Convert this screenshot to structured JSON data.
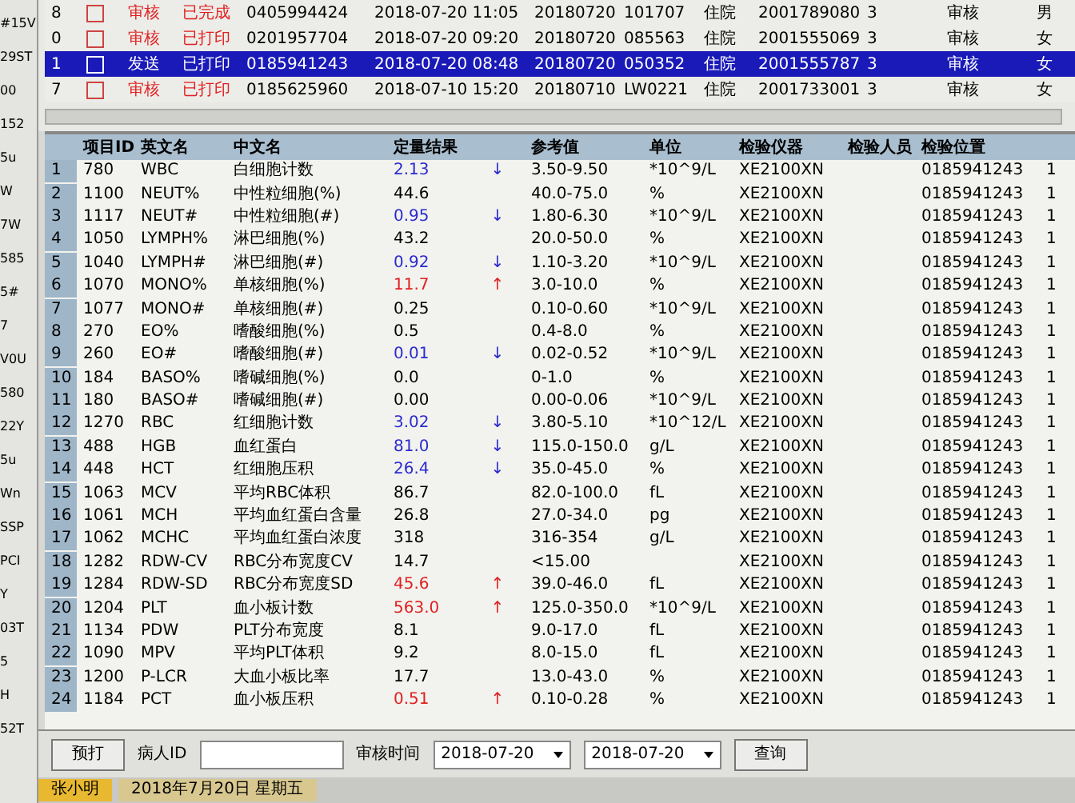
{
  "side_strip": [
    "#15V",
    "29ST",
    "00",
    "152",
    "5u",
    "W",
    "7W",
    "585",
    "5#",
    "7",
    "V0U",
    "580",
    "22Y",
    "5u",
    "Wn",
    "SSP",
    "PCI",
    "Y",
    "03T",
    "5",
    "H",
    "52T"
  ],
  "samples": [
    {
      "index": "8",
      "checked": false,
      "selected": false,
      "status": "审核",
      "kind": "alert",
      "print": "已完成",
      "number": "0405994424",
      "time": "2018-07-20 11:05",
      "date": "20180720",
      "code": "101707",
      "ward": "住院",
      "patient": "2001789080",
      "count": "3",
      "state": "审核",
      "sex": "男"
    },
    {
      "index": "0",
      "checked": false,
      "selected": false,
      "status": "审核",
      "kind": "alert",
      "print": "已打印",
      "number": "0201957704",
      "time": "2018-07-20 09:20",
      "date": "20180720",
      "code": "085563",
      "ward": "住院",
      "patient": "2001555069",
      "count": "3",
      "state": "审核",
      "sex": "女"
    },
    {
      "index": "1",
      "checked": false,
      "selected": true,
      "status": "发送",
      "kind": "normal",
      "print": "已打印",
      "number": "0185941243",
      "time": "2018-07-20 08:48",
      "date": "20180720",
      "code": "050352",
      "ward": "住院",
      "patient": "2001555787",
      "count": "3",
      "state": "审核",
      "sex": "女"
    },
    {
      "index": "7",
      "checked": false,
      "selected": false,
      "status": "审核",
      "kind": "alert",
      "print": "已打印",
      "number": "0185625960",
      "time": "2018-07-10 15:20",
      "date": "20180710",
      "code": "LW0221",
      "ward": "住院",
      "patient": "2001733001",
      "count": "3",
      "state": "审核",
      "sex": "女"
    }
  ],
  "results": {
    "columns": [
      "项目ID",
      "英文名",
      "中文名",
      "定量结果",
      "参考值",
      "单位",
      "检验仪器",
      "检验人员",
      "检验位置"
    ],
    "rows": [
      {
        "no": "1",
        "id": "780",
        "en": "WBC",
        "cn": "白细胞计数",
        "result": "2.13",
        "kind": "low",
        "flag": "↓",
        "ref": "3.50-9.50",
        "unit": "*10^9/L",
        "instrument": "XE2100XN",
        "location": "0185941243",
        "column_11": "1"
      },
      {
        "no": "2",
        "id": "1100",
        "en": "NEUT%",
        "cn": "中性粒细胞(%)",
        "result": "44.6",
        "kind": "normal",
        "ref": "40.0-75.0",
        "unit": "%",
        "instrument": "XE2100XN",
        "location": "0185941243",
        "column_11": "1"
      },
      {
        "no": "3",
        "id": "1117",
        "en": "NEUT#",
        "cn": "中性粒细胞(#)",
        "result": "0.95",
        "kind": "low",
        "flag": "↓",
        "ref": "1.80-6.30",
        "unit": "*10^9/L",
        "instrument": "XE2100XN",
        "location": "0185941243",
        "column_11": "1"
      },
      {
        "no": "4",
        "id": "1050",
        "en": "LYMPH%",
        "cn": "淋巴细胞(%)",
        "result": "43.2",
        "kind": "normal",
        "ref": "20.0-50.0",
        "unit": "%",
        "instrument": "XE2100XN",
        "location": "0185941243",
        "column_11": "1"
      },
      {
        "no": "5",
        "id": "1040",
        "en": "LYMPH#",
        "cn": "淋巴细胞(#)",
        "result": "0.92",
        "kind": "low",
        "flag": "↓",
        "ref": "1.10-3.20",
        "unit": "*10^9/L",
        "instrument": "XE2100XN",
        "location": "0185941243",
        "column_11": "1"
      },
      {
        "no": "6",
        "id": "1070",
        "en": "MONO%",
        "cn": "单核细胞(%)",
        "result": "11.7",
        "kind": "high",
        "flag": "↑",
        "ref": "3.0-10.0",
        "unit": "%",
        "instrument": "XE2100XN",
        "location": "0185941243",
        "column_11": "1"
      },
      {
        "no": "7",
        "id": "1077",
        "en": "MONO#",
        "cn": "单核细胞(#)",
        "result": "0.25",
        "kind": "normal",
        "ref": "0.10-0.60",
        "unit": "*10^9/L",
        "instrument": "XE2100XN",
        "location": "0185941243",
        "column_11": "1"
      },
      {
        "no": "8",
        "id": "270",
        "en": "EO%",
        "cn": "嗜酸细胞(%)",
        "result": "0.5",
        "kind": "normal",
        "ref": "0.4-8.0",
        "unit": "%",
        "instrument": "XE2100XN",
        "location": "0185941243",
        "column_11": "1"
      },
      {
        "no": "9",
        "id": "260",
        "en": "EO#",
        "cn": "嗜酸细胞(#)",
        "result": "0.01",
        "kind": "low",
        "flag": "↓",
        "ref": "0.02-0.52",
        "unit": "*10^9/L",
        "instrument": "XE2100XN",
        "location": "0185941243",
        "column_11": "1"
      },
      {
        "no": "10",
        "id": "184",
        "en": "BASO%",
        "cn": "嗜碱细胞(%)",
        "result": "0.0",
        "kind": "normal",
        "ref": "0-1.0",
        "unit": "%",
        "instrument": "XE2100XN",
        "location": "0185941243",
        "column_11": "1"
      },
      {
        "no": "11",
        "id": "180",
        "en": "BASO#",
        "cn": "嗜碱细胞(#)",
        "result": "0.00",
        "kind": "normal",
        "ref": "0.00-0.06",
        "unit": "*10^9/L",
        "instrument": "XE2100XN",
        "location": "0185941243",
        "column_11": "1"
      },
      {
        "no": "12",
        "id": "1270",
        "en": "RBC",
        "cn": "红细胞计数",
        "result": "3.02",
        "kind": "low",
        "flag": "↓",
        "ref": "3.80-5.10",
        "unit": "*10^12/L",
        "instrument": "XE2100XN",
        "location": "0185941243",
        "column_11": "1"
      },
      {
        "no": "13",
        "id": "488",
        "en": "HGB",
        "cn": "血红蛋白",
        "result": "81.0",
        "kind": "low",
        "flag": "↓",
        "ref": "115.0-150.0",
        "unit": "g/L",
        "instrument": "XE2100XN",
        "location": "0185941243",
        "column_11": "1"
      },
      {
        "no": "14",
        "id": "448",
        "en": "HCT",
        "cn": "红细胞压积",
        "result": "26.4",
        "kind": "low",
        "flag": "↓",
        "ref": "35.0-45.0",
        "unit": "%",
        "instrument": "XE2100XN",
        "location": "0185941243",
        "column_11": "1"
      },
      {
        "no": "15",
        "id": "1063",
        "en": "MCV",
        "cn": "平均RBC体积",
        "result": "86.7",
        "kind": "normal",
        "ref": "82.0-100.0",
        "unit": "fL",
        "instrument": "XE2100XN",
        "location": "0185941243",
        "column_11": "1"
      },
      {
        "no": "16",
        "id": "1061",
        "en": "MCH",
        "cn": "平均血红蛋白含量",
        "result": "26.8",
        "kind": "normal",
        "ref": "27.0-34.0",
        "unit": "pg",
        "instrument": "XE2100XN",
        "location": "0185941243",
        "column_11": "1"
      },
      {
        "no": "17",
        "id": "1062",
        "en": "MCHC",
        "cn": "平均血红蛋白浓度",
        "result": "318",
        "kind": "normal",
        "ref": "316-354",
        "unit": "g/L",
        "instrument": "XE2100XN",
        "location": "0185941243",
        "column_11": "1"
      },
      {
        "no": "18",
        "id": "1282",
        "en": "RDW-CV",
        "cn": "RBC分布宽度CV",
        "result": "14.7",
        "kind": "normal",
        "ref": "<15.00",
        "instrument": "XE2100XN",
        "location": "0185941243",
        "column_11": "1"
      },
      {
        "no": "19",
        "id": "1284",
        "en": "RDW-SD",
        "cn": "RBC分布宽度SD",
        "result": "45.6",
        "kind": "high",
        "flag": "↑",
        "ref": "39.0-46.0",
        "unit": "fL",
        "instrument": "XE2100XN",
        "location": "0185941243",
        "column_11": "1"
      },
      {
        "no": "20",
        "id": "1204",
        "en": "PLT",
        "cn": "血小板计数",
        "result": "563.0",
        "kind": "high",
        "flag": "↑",
        "ref": "125.0-350.0",
        "unit": "*10^9/L",
        "instrument": "XE2100XN",
        "location": "0185941243",
        "column_11": "1"
      },
      {
        "no": "21",
        "id": "1134",
        "en": "PDW",
        "cn": "PLT分布宽度",
        "result": "8.1",
        "kind": "normal",
        "ref": "9.0-17.0",
        "unit": "fL",
        "instrument": "XE2100XN",
        "location": "0185941243",
        "column_11": "1"
      },
      {
        "no": "22",
        "id": "1090",
        "en": "MPV",
        "cn": "平均PLT体积",
        "result": "9.2",
        "kind": "normal",
        "ref": "8.0-15.0",
        "unit": "fL",
        "instrument": "XE2100XN",
        "location": "0185941243",
        "column_11": "1"
      },
      {
        "no": "23",
        "id": "1200",
        "en": "P-LCR",
        "cn": "大血小板比率",
        "result": "17.7",
        "kind": "normal",
        "ref": "13.0-43.0",
        "unit": "%",
        "instrument": "XE2100XN",
        "location": "0185941243",
        "column_11": "1"
      },
      {
        "no": "24",
        "id": "1184",
        "en": "PCT",
        "cn": "血小板压积",
        "result": "0.51",
        "kind": "high",
        "flag": "↑",
        "ref": "0.10-0.28",
        "unit": "%",
        "instrument": "XE2100XN",
        "location": "0185941243",
        "column_11": "1"
      }
    ]
  },
  "filter": {
    "print_button": "预打",
    "patient_label": "病人ID",
    "time_label": "审核时间",
    "date_from": "2018-07-20",
    "date_to": "2018-07-20",
    "query_button": "查询"
  },
  "taskbar": [
    {
      "label": "张小明",
      "selected": true
    },
    {
      "label": "2018年7月20日 星期五",
      "selected": false
    }
  ]
}
